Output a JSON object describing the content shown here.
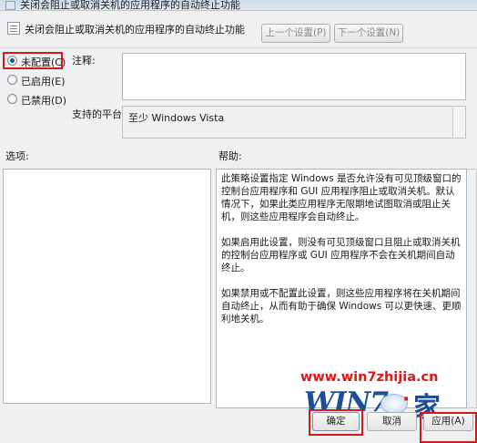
{
  "window": {
    "title": "关闭会阻止或取消关机的应用程序的自动终止功能"
  },
  "header": {
    "policy_title": "关闭会阻止或取消关机的应用程序的自动终止功能",
    "prev_button": "上一个设置(P)",
    "next_button": "下一个设置(N)"
  },
  "options": {
    "not_configured": "未配置(C)",
    "enabled": "已启用(E)",
    "disabled": "已禁用(D)",
    "selected": "未配置(C)"
  },
  "fields": {
    "comment_label": "注释:",
    "comment_value": "",
    "platform_label": "支持的平台:",
    "platform_value": "至少 Windows Vista"
  },
  "panels": {
    "options_label": "选项:",
    "help_label": "帮助:",
    "help_paragraphs": [
      "此策略设置指定 Windows 是否允许没有可见顶级窗口的控制台应用程序和 GUI 应用程序阻止或取消关机。默认情况下，如果此类应用程序无限期地试图取消或阻止关机，则这些应用程序会自动终止。",
      "如果启用此设置，则没有可见顶级窗口且阻止或取消关机的控制台应用程序或 GUI 应用程序不会在关机期间自动终止。",
      "如果禁用或不配置此设置，则这些应用程序将在关机期间自动终止，从而有助于确保 Windows 可以更快速、更顺利地关机。"
    ]
  },
  "footer": {
    "ok_button": "确定",
    "cancel_button": "取消",
    "apply_button": "应用(A)"
  },
  "watermark": {
    "url": "www.win7zhijia.cn",
    "logo_text": "WIN7",
    "logo_suffix": "家"
  },
  "colors": {
    "highlight": "#d11a1a",
    "watermark_blue": "#1e4e9a"
  }
}
